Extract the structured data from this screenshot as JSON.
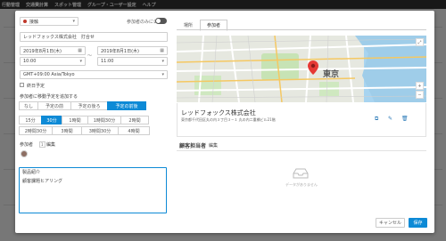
{
  "topnav": {
    "items": [
      "行動管理",
      "交通費計算",
      "スポット管理",
      "グループ・ユーザー設定",
      "ヘルプ"
    ]
  },
  "form": {
    "category": "接触",
    "participants_only_label": "参加者のみに公開",
    "title_value": "レッドフォックス株式会社　打合せ",
    "start_date": "2019年8月1日(木)",
    "end_date": "2019年8月1日(木)",
    "range_separator": "〜",
    "start_time": "10:00",
    "end_time": "11:00",
    "timezone": "GMT+09:00 Asia/Tokyo",
    "all_day_label": "終日予定",
    "travel_label": "参加者に移動予定を追加する",
    "travel_options": [
      "なし",
      "予定の前",
      "予定の後ろ",
      "予定の前後"
    ],
    "travel_selected": 3,
    "duration_options_row1": [
      "15分",
      "30分",
      "1時間",
      "1時間30分",
      "2時間"
    ],
    "duration_options_row2": [
      "2時間30分",
      "3時間",
      "3時間30分",
      "4時間"
    ],
    "duration_selected": "30分",
    "participants_label": "参加者",
    "participants_count": "1",
    "edit_label": "編集",
    "memo_text": "製品紹介\n\n顧客課題ヒアリング"
  },
  "right": {
    "tabs": [
      "場所",
      "参加者"
    ],
    "active_tab": 1,
    "map_label_kanji": "東京",
    "place_name": "レッドフォックス株式会社",
    "place_address": "東京都千代田区丸の内３丁目３−１ 丸の内二重橋ビル21階",
    "client_label": "顧客担当者",
    "client_edit": "編集",
    "empty_text": "データがありません"
  },
  "buttons": {
    "cancel": "キャンセル",
    "save": "保存"
  },
  "colors": {
    "accent": "#0d8ad6",
    "category_dot": "#c0392b",
    "pin": "#e53935"
  },
  "icons": [
    "chevron-down-icon",
    "calendar-icon",
    "toggle",
    "checkbox",
    "avatar-icon",
    "fullscreen-icon",
    "zoom-in-icon",
    "zoom-out-icon",
    "pin-icon",
    "open-link-icon",
    "edit-icon",
    "trash-icon",
    "empty-inbox-icon"
  ]
}
